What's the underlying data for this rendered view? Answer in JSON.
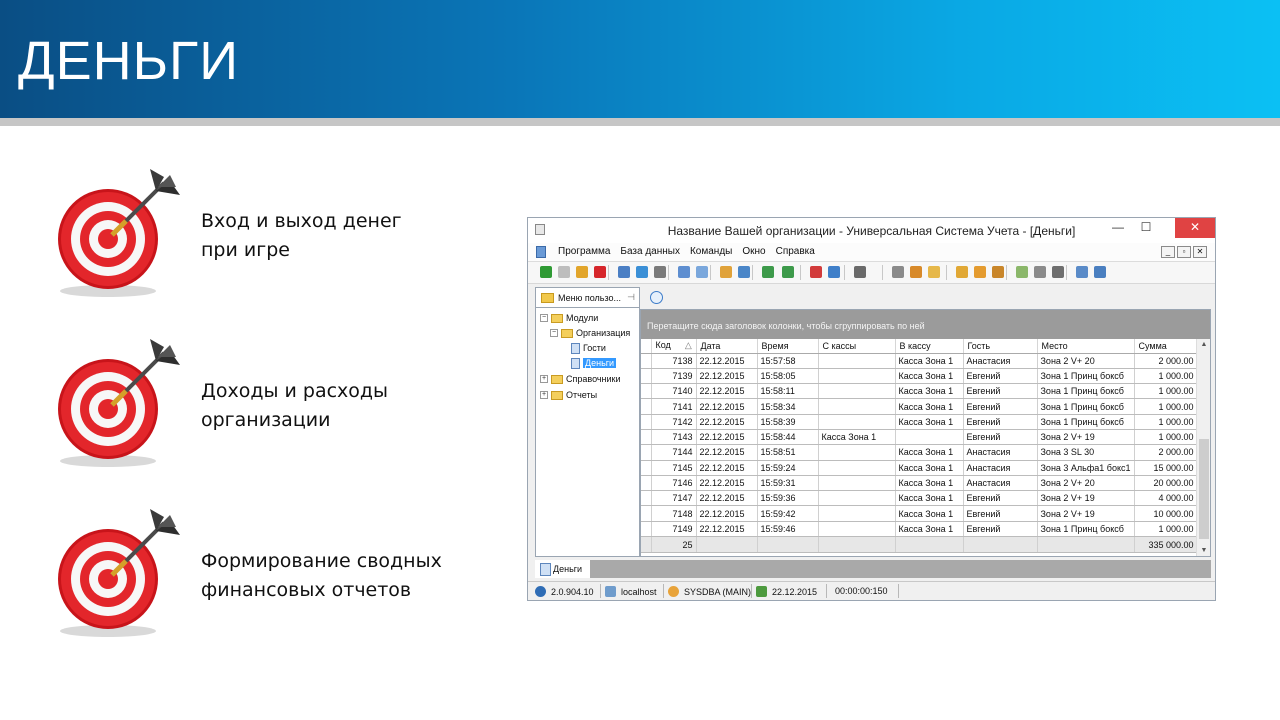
{
  "slide": {
    "title": "ДЕНЬГИ",
    "bullets": [
      {
        "text": "Вход и выход денег\nпри игре",
        "icon": "target-dart-icon"
      },
      {
        "text": "Доходы и расходы\nорганизации",
        "icon": "target-dart-icon"
      },
      {
        "text": "Формирование сводных\nфинансовых отчетов",
        "icon": "target-dart-icon"
      }
    ]
  },
  "window": {
    "title": "Название Вашей организации - Универсальная Система Учета - [Деньги]",
    "controls": {
      "minimize": "—",
      "maximize": "☐",
      "close": "✕"
    },
    "menu": [
      "Программа",
      "База данных",
      "Команды",
      "Окно",
      "Справка"
    ],
    "mdi_controls": [
      "_",
      "▫",
      "✕"
    ]
  },
  "left_pane": {
    "tab_label": "Меню пользо...",
    "pin": "⊣",
    "tree": [
      {
        "label": "Модули",
        "level": 0,
        "type": "folder",
        "toggle": "−"
      },
      {
        "label": "Организация",
        "level": 1,
        "type": "folder",
        "toggle": "−"
      },
      {
        "label": "Гости",
        "level": 2,
        "type": "doc"
      },
      {
        "label": "Деньги",
        "level": 2,
        "type": "doc",
        "selected": true
      },
      {
        "label": "Справочники",
        "level": 0,
        "type": "folder",
        "toggle": "+"
      },
      {
        "label": "Отчеты",
        "level": 0,
        "type": "folder",
        "toggle": "+"
      }
    ]
  },
  "grid": {
    "group_hint": "Перетащите сюда заголовок колонки, чтобы сгруппировать по ней",
    "columns": [
      "Код",
      "Дата",
      "Время",
      "С кассы",
      "В кассу",
      "Гость",
      "Место",
      "Сумма"
    ],
    "sort_indicator": "△",
    "rows": [
      [
        "7138",
        "22.12.2015",
        "15:57:58",
        "",
        "Касса Зона 1",
        "Анастасия",
        "Зона 2 V+ 20",
        "2 000.00"
      ],
      [
        "7139",
        "22.12.2015",
        "15:58:05",
        "",
        "Касса Зона 1",
        "Евгений",
        "Зона 1 Принц боксб",
        "1 000.00"
      ],
      [
        "7140",
        "22.12.2015",
        "15:58:11",
        "",
        "Касса Зона 1",
        "Евгений",
        "Зона 1 Принц боксб",
        "1 000.00"
      ],
      [
        "7141",
        "22.12.2015",
        "15:58:34",
        "",
        "Касса Зона 1",
        "Евгений",
        "Зона 1 Принц боксб",
        "1 000.00"
      ],
      [
        "7142",
        "22.12.2015",
        "15:58:39",
        "",
        "Касса Зона 1",
        "Евгений",
        "Зона 1 Принц боксб",
        "1 000.00"
      ],
      [
        "7143",
        "22.12.2015",
        "15:58:44",
        "Касса Зона 1",
        "",
        "Евгений",
        "Зона 2 V+ 19",
        "1 000.00"
      ],
      [
        "7144",
        "22.12.2015",
        "15:58:51",
        "",
        "Касса Зона 1",
        "Анастасия",
        "Зона 3 SL 30",
        "2 000.00"
      ],
      [
        "7145",
        "22.12.2015",
        "15:59:24",
        "",
        "Касса Зона 1",
        "Анастасия",
        "Зона 3 Альфа1 бокс1",
        "15 000.00"
      ],
      [
        "7146",
        "22.12.2015",
        "15:59:31",
        "",
        "Касса Зона 1",
        "Анастасия",
        "Зона 2 V+ 20",
        "20 000.00"
      ],
      [
        "7147",
        "22.12.2015",
        "15:59:36",
        "",
        "Касса Зона 1",
        "Евгений",
        "Зона 2 V+ 19",
        "4 000.00"
      ],
      [
        "7148",
        "22.12.2015",
        "15:59:42",
        "",
        "Касса Зона 1",
        "Евгений",
        "Зона 2 V+ 19",
        "10 000.00"
      ],
      [
        "7149",
        "22.12.2015",
        "15:59:46",
        "",
        "Касса Зона 1",
        "Евгений",
        "Зона 1 Принц боксб",
        "1 000.00"
      ]
    ],
    "footer": {
      "count": "25",
      "total": "335 000.00"
    }
  },
  "doc_tab": {
    "label": "Деньги"
  },
  "status": {
    "version": "2.0.904.10",
    "host": "localhost",
    "user": "SYSDBA (MAIN)",
    "date": "22.12.2015",
    "timer": "00:00:00:150"
  },
  "colors": {
    "header_start": "#0a4e84",
    "header_end": "#0bc0f4",
    "close_btn": "#e04343",
    "selection": "#3399ff"
  }
}
